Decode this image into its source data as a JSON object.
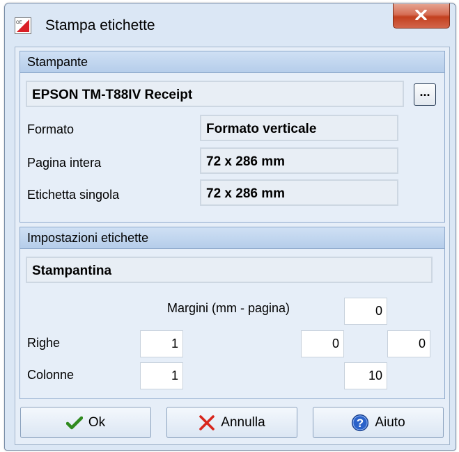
{
  "window": {
    "title": "Stampa etichette"
  },
  "icons": {
    "app": "app-logo-icon",
    "close": "close-icon",
    "ok": "checkmark-icon",
    "cancel": "cancel-x-icon",
    "help": "help-question-icon"
  },
  "printer_group": {
    "header": "Stampante",
    "printer_name": "EPSON TM-T88IV Receipt",
    "browse_label": "...",
    "format_label": "Formato",
    "format_value": "Formato verticale",
    "full_page_label": "Pagina intera",
    "full_page_value": "72 x 286 mm",
    "single_label_label": "Etichetta singola",
    "single_label_value": "72 x 286 mm"
  },
  "label_group": {
    "header": "Impostazioni etichette",
    "preset": "Stampantina",
    "margins_label": "Margini (mm - pagina)",
    "margin_top": "0",
    "margin_left": "0",
    "margin_right": "0",
    "margin_bottom": "10",
    "rows_label": "Righe",
    "rows_value": "1",
    "columns_label": "Colonne",
    "columns_value": "1"
  },
  "buttons": {
    "ok": "Ok",
    "cancel": "Annulla",
    "help": "Aiuto"
  },
  "colors": {
    "accent": "#dbe7f5",
    "close": "#c3401f",
    "check": "#2f8a1e",
    "cancel_x": "#d8261c",
    "help": "#2a62c9"
  }
}
